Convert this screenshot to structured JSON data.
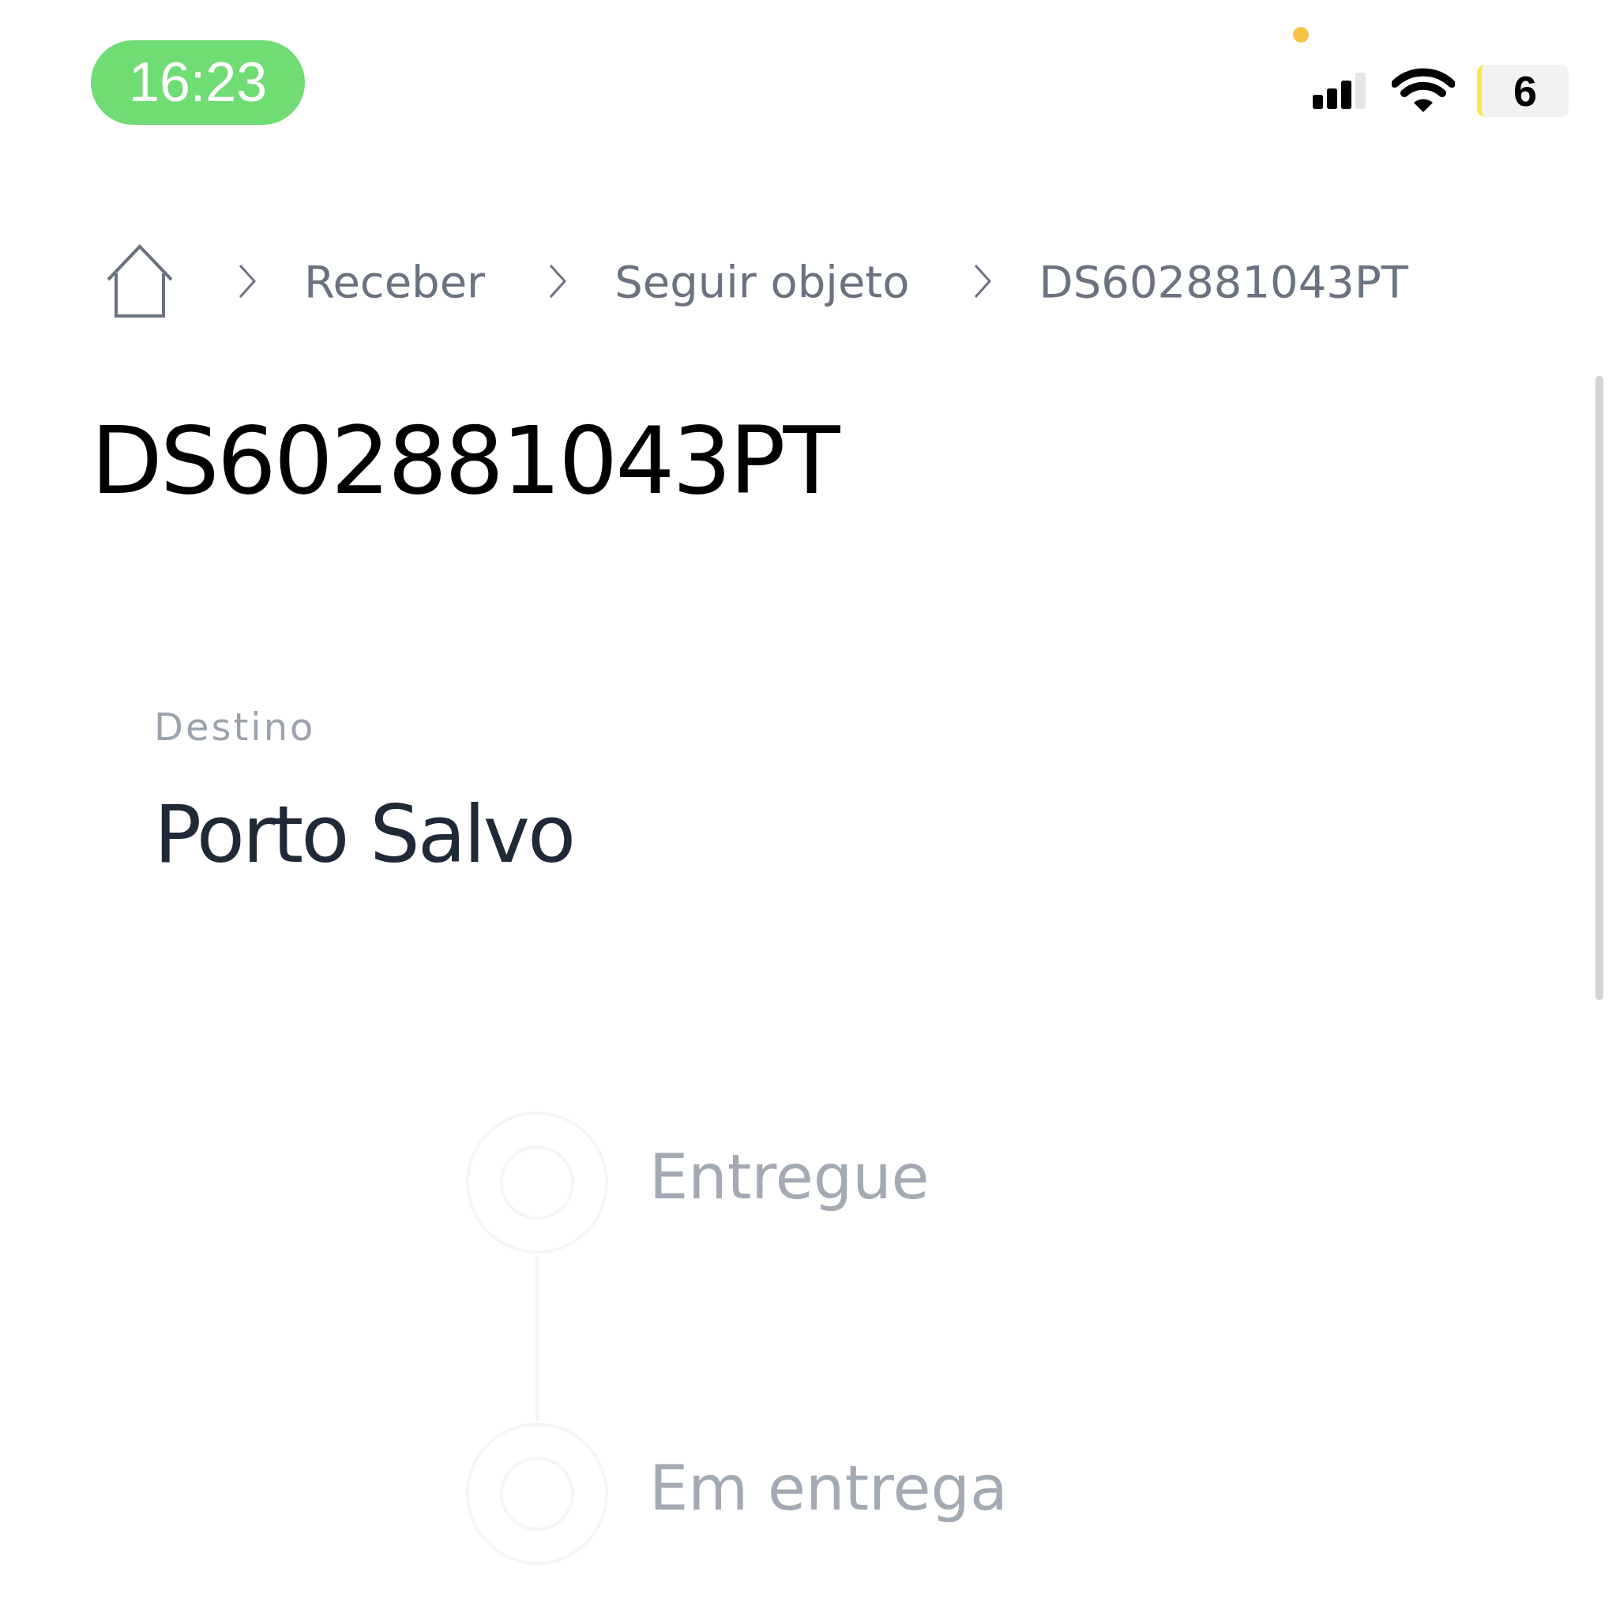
{
  "status_bar": {
    "time": "16:23",
    "battery": "6"
  },
  "breadcrumb": [
    "Receber",
    "Seguir objeto",
    "DS602881043PT"
  ],
  "title": "DS602881043PT",
  "destination": {
    "label": "Destino",
    "value": "Porto Salvo"
  },
  "timeline": [
    {
      "label": "Entregue"
    },
    {
      "label": "Em entrega"
    }
  ]
}
